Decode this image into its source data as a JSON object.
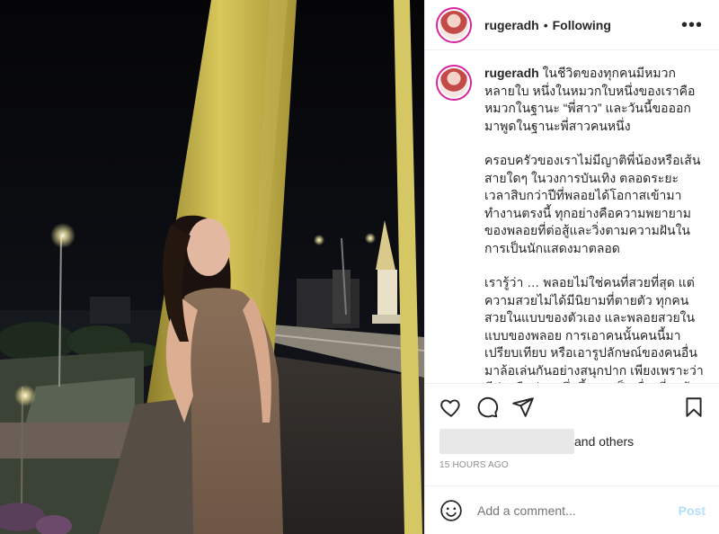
{
  "post": {
    "username": "rugeradh",
    "separator": "•",
    "follow_status": "Following",
    "more_label": "•••"
  },
  "caption": {
    "username": "rugeradh",
    "paragraphs": [
      "ในชีวิตของทุกคนมีหมวกหลายใบ หนึ่งในหมวกใบหนึ่งของเราคือหมวกในฐานะ “พี่สาว” และวันนี้ขอออกมาพูดในฐานะพี่สาวคนหนึ่ง",
      "ครอบครัวของเราไม่มีญาติพี่น้องหรือเส้นสายใดๆ ในวงการบันเทิง ตลอดระยะเวลาสิบกว่าปีที่พลอยได้โอกาสเข้ามาทำงานตรงนี้ ทุกอย่างคือความพยายามของพลอยที่ต่อสู้และวิ่งตามความฝันในการเป็นนักแสดงมาตลอด",
      "เรารู้ว่า … พลอยไม่ใช่คนที่สวยที่สุด แต่ความสวยไม่ได้มีนิยามที่ตายตัว ทุกคนสวยในแบบของตัวเอง และพลอยสวยในแบบของพลอย การเอาคนนั้นคนนี้มาเปรียบเทียบ หรือเอารูปลักษณ์ของคนอื่นมาล้อเล่นกันอย่างสนุกปาก เพียงเพราะว่ามีข่าวลือข่าวหนึ่งขึ้นมา เป็นเรื่องที่ถูกต้องเป็นธรรมแล้วเหรอ?"
    ]
  },
  "likes": {
    "others_label": "and others"
  },
  "timestamp": "15 HOURS AGO",
  "comment": {
    "placeholder": "Add a comment...",
    "post_label": "Post"
  },
  "icons": {
    "like": "heart-icon",
    "comment": "comment-icon",
    "share": "share-icon",
    "save": "bookmark-icon",
    "emoji": "emoji-icon",
    "more": "more-icon"
  },
  "colors": {
    "text": "#262626",
    "muted": "#8e8e8e",
    "post_disabled": "#b2dffc",
    "divider": "#efefef",
    "story_ring": "#d6249f"
  }
}
